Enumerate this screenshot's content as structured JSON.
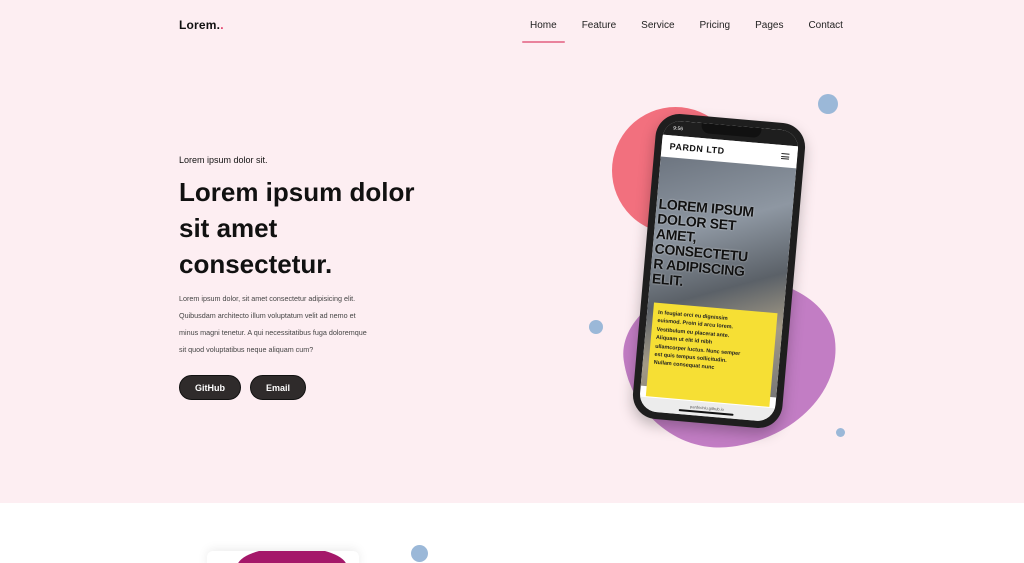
{
  "brand": {
    "name": "Lorem.",
    "dot": "."
  },
  "nav": {
    "items": [
      {
        "label": "Home",
        "active": true
      },
      {
        "label": "Feature"
      },
      {
        "label": "Service"
      },
      {
        "label": "Pricing"
      },
      {
        "label": "Pages"
      },
      {
        "label": "Contact"
      }
    ]
  },
  "hero": {
    "eyebrow": "Lorem ipsum dolor sit.",
    "headline": [
      "Lorem ipsum dolor",
      "sit amet",
      "consectetur."
    ],
    "description": [
      "Lorem ipsum dolor, sit amet consectetur adipisicing elit.",
      "Quibusdam architecto illum voluptatum velit ad nemo et",
      "minus magni tenetur. A qui necessitatibus fuga doloremque",
      "sit quod voluptatibus neque aliquam cum?"
    ],
    "buttons": {
      "github": "GitHub",
      "email": "Email"
    }
  },
  "phone": {
    "time": "9:56",
    "app_title": "PARDN LTD",
    "headline": [
      "LOREM IPSUM",
      "DOLOR SET",
      "AMET,",
      "CONSECTETU",
      "R ADIPISCING",
      "ELIT."
    ],
    "card_text": [
      "In feugiat orci eu dignissim",
      "euismod. Proin id arcu lorem.",
      "Vestibulum eu placerat ante.",
      "Aliquam ut elit id nibh",
      "ullamcorper luctus. Nunc semper",
      "est quis tempus sollicitudin.",
      "Nullam consequat nunc"
    ],
    "url": "pardnchiu.github.io"
  },
  "colors": {
    "hero_bg": "#fdeef2",
    "accent": "#e9829c",
    "blob_red": "#f2707e",
    "blob_purple": "#c27dc4",
    "dot_blue": "#9bb8d8",
    "button_bg": "#2f2b2b",
    "card_yellow": "#f6df34"
  },
  "icons": {
    "menu": "hamburger-icon"
  }
}
